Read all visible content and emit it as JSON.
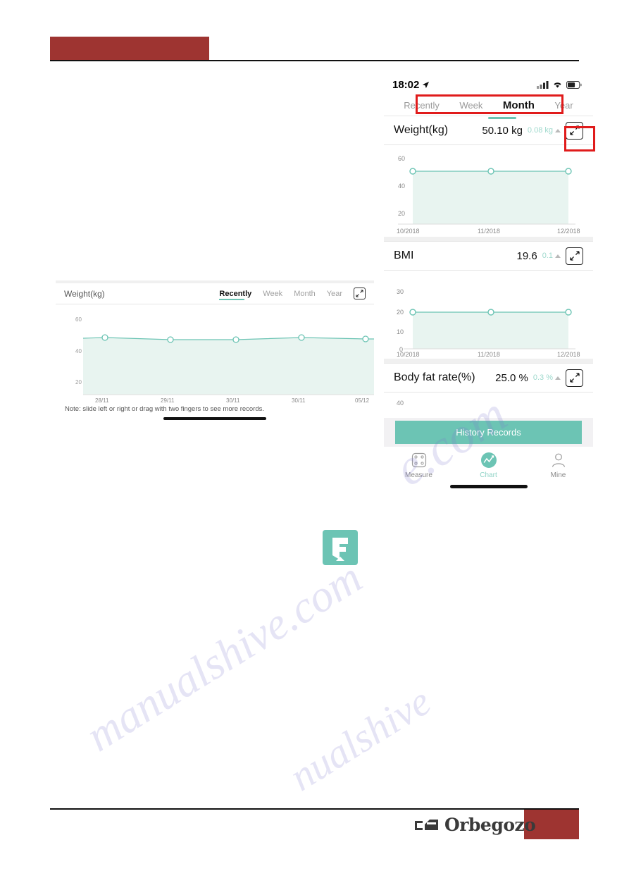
{
  "document": {
    "footer_brand": "Orbegozo",
    "footer_logo_icon": "orbegozo-logo-icon",
    "header_band_color": "#9e3431",
    "footer_band_color": "#9e3431"
  },
  "watermark": {
    "line1": "manualshive.com",
    "line2": "e.com",
    "line3": "nualshive"
  },
  "app_icon": {
    "name": "fitness-app-icon",
    "background": "#6cc4b4",
    "glyph": "F"
  },
  "phone_right": {
    "status_bar": {
      "time": "18:02",
      "location_icon": "location-arrow-icon",
      "signal_icon": "cellular-signal-icon",
      "wifi_icon": "wifi-icon",
      "battery_icon": "battery-icon"
    },
    "tabs": [
      {
        "label": "Recently",
        "active": false
      },
      {
        "label": "Week",
        "active": false
      },
      {
        "label": "Month",
        "active": true
      },
      {
        "label": "Year",
        "active": false
      }
    ],
    "accent_color": "#6cc4b4",
    "highlight_color": "#e01b1b",
    "metrics": [
      {
        "name": "Weight(kg)",
        "value": "50.10 kg",
        "delta": "0.08 kg",
        "trend_icon": "triangle-up-icon",
        "expand_icon": "expand-arrows-icon"
      },
      {
        "name": "BMI",
        "value": "19.6",
        "delta": "0.1",
        "trend_icon": "triangle-up-icon",
        "expand_icon": "expand-arrows-icon"
      },
      {
        "name": "Body fat rate(%)",
        "value": "25.0 %",
        "delta": "0.3 %",
        "trend_icon": "triangle-up-icon",
        "expand_icon": "expand-arrows-icon"
      }
    ],
    "partial_axis_label": "40",
    "history_button": "History Records",
    "tabbar": [
      {
        "label": "Measure",
        "icon": "scale-icon",
        "active": false
      },
      {
        "label": "Chart",
        "icon": "chart-line-icon",
        "active": true
      },
      {
        "label": "Mine",
        "icon": "person-icon",
        "active": false
      }
    ]
  },
  "phone_left": {
    "title": "Weight(kg)",
    "tabs": [
      {
        "label": "Recently",
        "active": true
      },
      {
        "label": "Week",
        "active": false
      },
      {
        "label": "Month",
        "active": false
      },
      {
        "label": "Year",
        "active": false
      }
    ],
    "expand_icon": "expand-arrows-icon",
    "note": "Note: slide left or right or drag with two fingers to see more records.",
    "accent_color": "#6cc4b4"
  },
  "chart_data": [
    {
      "id": "weight-month-chart",
      "type": "area",
      "title": "Weight(kg)",
      "x": [
        "10/2018",
        "11/2018",
        "12/2018"
      ],
      "values": [
        50.1,
        50.1,
        50.1
      ],
      "ylabel": "",
      "xlabel": "",
      "yticks": [
        20,
        40,
        60
      ],
      "ylim": [
        0,
        68
      ],
      "line_color": "#6cc4b4",
      "fill_color": "#e8f4f0",
      "grid": false,
      "legend": "none"
    },
    {
      "id": "bmi-month-chart",
      "type": "area",
      "title": "BMI",
      "x": [
        "10/2018",
        "11/2018",
        "12/2018"
      ],
      "values": [
        19.6,
        19.6,
        19.6
      ],
      "ylabel": "",
      "xlabel": "",
      "yticks": [
        0,
        10,
        20,
        30
      ],
      "ylim": [
        0,
        34
      ],
      "line_color": "#6cc4b4",
      "fill_color": "#e8f4f0",
      "grid": false,
      "legend": "none"
    },
    {
      "id": "bodyfat-month-chart",
      "type": "area",
      "title": "Body fat rate(%)",
      "x": [],
      "values": [],
      "yticks": [
        40
      ],
      "ylim": [
        0,
        45
      ],
      "line_color": "#6cc4b4",
      "fill_color": "#e8f4f0",
      "grid": false,
      "legend": "none"
    },
    {
      "id": "weight-recently-chart",
      "type": "area",
      "title": "Weight(kg)",
      "x": [
        "28/11",
        "29/11",
        "30/11",
        "30/11",
        "05/12"
      ],
      "values": [
        50.2,
        49.8,
        49.9,
        50.2,
        50.0
      ],
      "ylabel": "",
      "xlabel": "",
      "yticks": [
        20,
        40,
        60
      ],
      "ylim": [
        12,
        66
      ],
      "line_color": "#6cc4b4",
      "fill_color": "#e8f4f0",
      "grid": false,
      "legend": "none"
    }
  ]
}
